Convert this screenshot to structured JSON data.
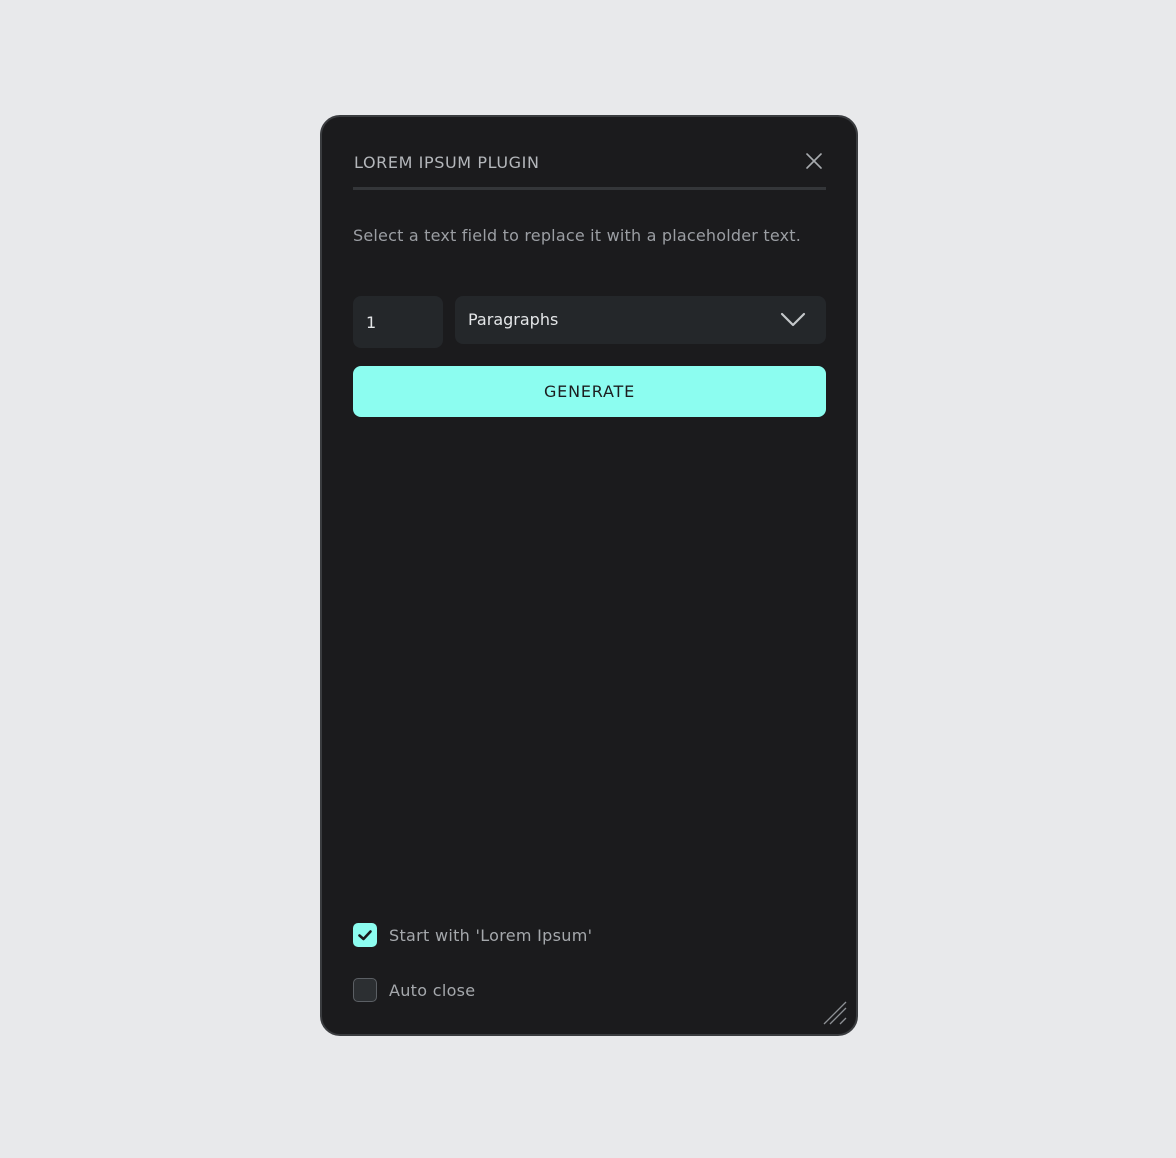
{
  "plugin": {
    "title": "LOREM IPSUM PLUGIN",
    "description": "Select a text field to replace it with a placeholder text."
  },
  "controls": {
    "count_value": "1",
    "unit_selected": "Paragraphs",
    "generate_label": "GENERATE"
  },
  "options": {
    "start_with_lorem": {
      "label": "Start with 'Lorem Ipsum'",
      "checked": true
    },
    "auto_close": {
      "label": "Auto close",
      "checked": false
    }
  },
  "icons": {
    "close": "close-icon",
    "dropdown": "chevron-down-icon",
    "checkmark": "checkmark-icon",
    "resize": "resize-grip-icon"
  },
  "colors": {
    "accent": "#8cfdf0",
    "panel_background": "#1b1b1d",
    "input_background": "#24272a",
    "page_background": "#e8e9eb"
  }
}
